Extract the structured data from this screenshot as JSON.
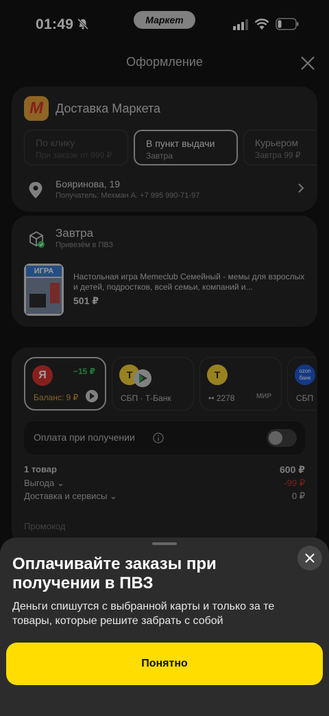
{
  "status_bar": {
    "time": "01:49",
    "pill": "Маркет"
  },
  "header": {
    "title": "Оформление"
  },
  "delivery": {
    "title": "Доставка Маркета",
    "options": [
      {
        "title": "По клику",
        "sub": "При заказе от 999 ₽"
      },
      {
        "title": "В пункт выдачи",
        "sub": "Завтра"
      },
      {
        "title": "Курьером",
        "sub": "Завтра   99 ₽"
      }
    ],
    "address": "Бояринова, 19",
    "recipient": "Получатель: Мехман А. +7 995 990-71-97"
  },
  "shipment": {
    "title": "Завтра",
    "subtitle": "Привезём в ПВЗ",
    "product_image_text": "ИГРА",
    "product_name": "Настольная игра Memeclub Семейный - мемы для взрослых и детей, подростков, всей семьи, компаний и...",
    "product_price": "501 ₽"
  },
  "payment": {
    "cards": [
      {
        "label": "Баланс: 9 ₽",
        "badge": "−15 ₽",
        "logo": "Я"
      },
      {
        "label": "СБП · Т-Банк",
        "logo": "Т"
      },
      {
        "label": "•• 2278",
        "logo": "Т",
        "brand": "МИР"
      },
      {
        "label": "СБП",
        "logo": "ozon банк"
      }
    ],
    "cod_label": "Оплата при получении",
    "summary": {
      "items_label": "1 товар",
      "items_value": "600 ₽",
      "benefit_label": "Выгода ⌄",
      "benefit_value": "-99 ₽",
      "delivery_label": "Доставка и сервисы ⌄",
      "delivery_value": "0 ₽"
    },
    "promo_placeholder": "Промокод"
  },
  "sheet": {
    "title": "Оплачивайте заказы при получении в ПВЗ",
    "text": "Деньги спишутся с выбранной карты и только за те товары, которые решите забрать с собой",
    "button": "Понятно"
  },
  "colors": {
    "accent": "#ffdd00",
    "negative": "#e0473a",
    "positive": "#34c759",
    "card_bg": "#262626"
  }
}
